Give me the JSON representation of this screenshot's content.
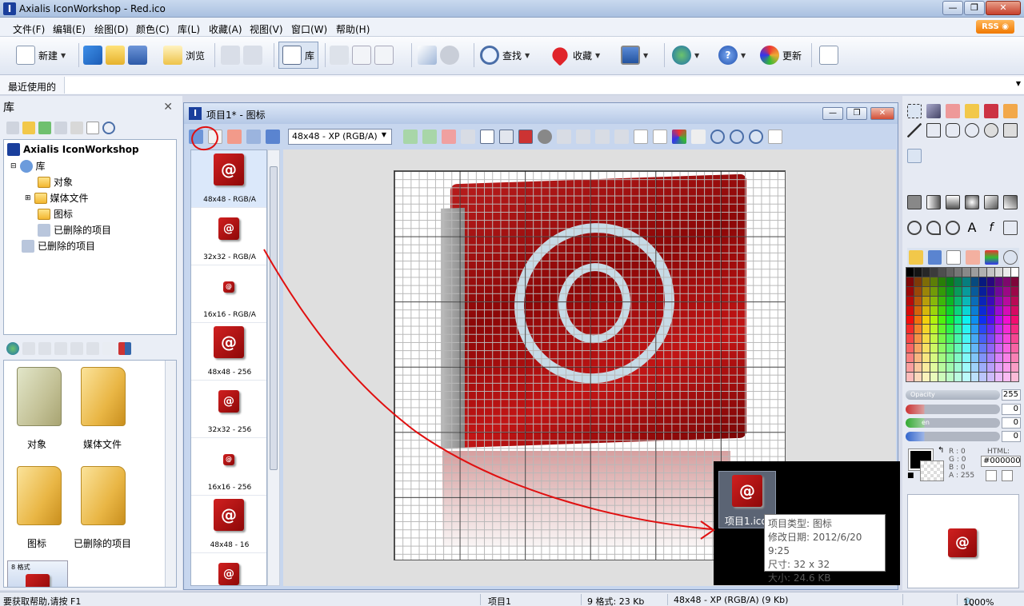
{
  "window": {
    "title": "Axialis IconWorkshop - Red.ico",
    "app_icon": "axialis-icon"
  },
  "menu": [
    "文件(F)",
    "编辑(E)",
    "绘图(D)",
    "颜色(C)",
    "库(L)",
    "收藏(A)",
    "视图(V)",
    "窗口(W)",
    "帮助(H)"
  ],
  "rss_label": "RSS",
  "toolbar": {
    "new": "新建",
    "browse": "浏览",
    "library": "库",
    "find": "查找",
    "favorites": "收藏",
    "update": "更新"
  },
  "recent_label": "最近使用的",
  "library_panel": {
    "title": "库",
    "tree": [
      {
        "label": "Axialis IconWorkshop",
        "depth": 0
      },
      {
        "label": "库",
        "depth": 1
      },
      {
        "label": "对象",
        "depth": 2
      },
      {
        "label": "媒体文件",
        "depth": 2
      },
      {
        "label": "图标",
        "depth": 2
      },
      {
        "label": "已删除的项目",
        "depth": 2
      },
      {
        "label": "已删除的项目",
        "depth": 1
      }
    ],
    "folders": [
      {
        "label": "对象"
      },
      {
        "label": "媒体文件"
      },
      {
        "label": "图标"
      },
      {
        "label": "已删除的项目"
      }
    ],
    "partial_item": "8 格式"
  },
  "document": {
    "title": "项目1* - 图标",
    "format_select": "48x48 - XP (RGB/A)",
    "formats": [
      {
        "label": "48x48 - RGB/A",
        "selected": true
      },
      {
        "label": "32x32 - RGB/A"
      },
      {
        "label": "16x16 - RGB/A"
      },
      {
        "label": "48x48 - 256"
      },
      {
        "label": "32x32 - 256"
      },
      {
        "label": "16x16 - 256"
      },
      {
        "label": "48x48 - 16"
      },
      {
        "label": ""
      }
    ]
  },
  "explorer": {
    "file_label": "项目1.ico",
    "tooltip": {
      "type": "项目类型: 图标",
      "modified": "修改日期: 2012/6/20 9:25",
      "size": "尺寸: 32 x 32",
      "filesize": "大小: 24.6 KB"
    }
  },
  "color_panel": {
    "opacity_label": "Opacity",
    "opacity_value": "255",
    "green_label": "en",
    "slider_values": [
      "0",
      "0",
      "0"
    ],
    "rgba": {
      "r": "R : 0",
      "g": "G : 0",
      "b": "B : 0",
      "a": "A : 255"
    },
    "html_label": "HTML:",
    "html_value": "#000000"
  },
  "status": {
    "help": "要获取帮助,请按 F1",
    "project": "项目1",
    "formats": "9 格式: 23 Kb",
    "current": "48x48 - XP (RGB/A) (9 Kb)",
    "zoom": "1000%"
  },
  "colors": {
    "accent": "#1a3f9c",
    "book_red": "#c21515",
    "annotation": "#e01010"
  }
}
